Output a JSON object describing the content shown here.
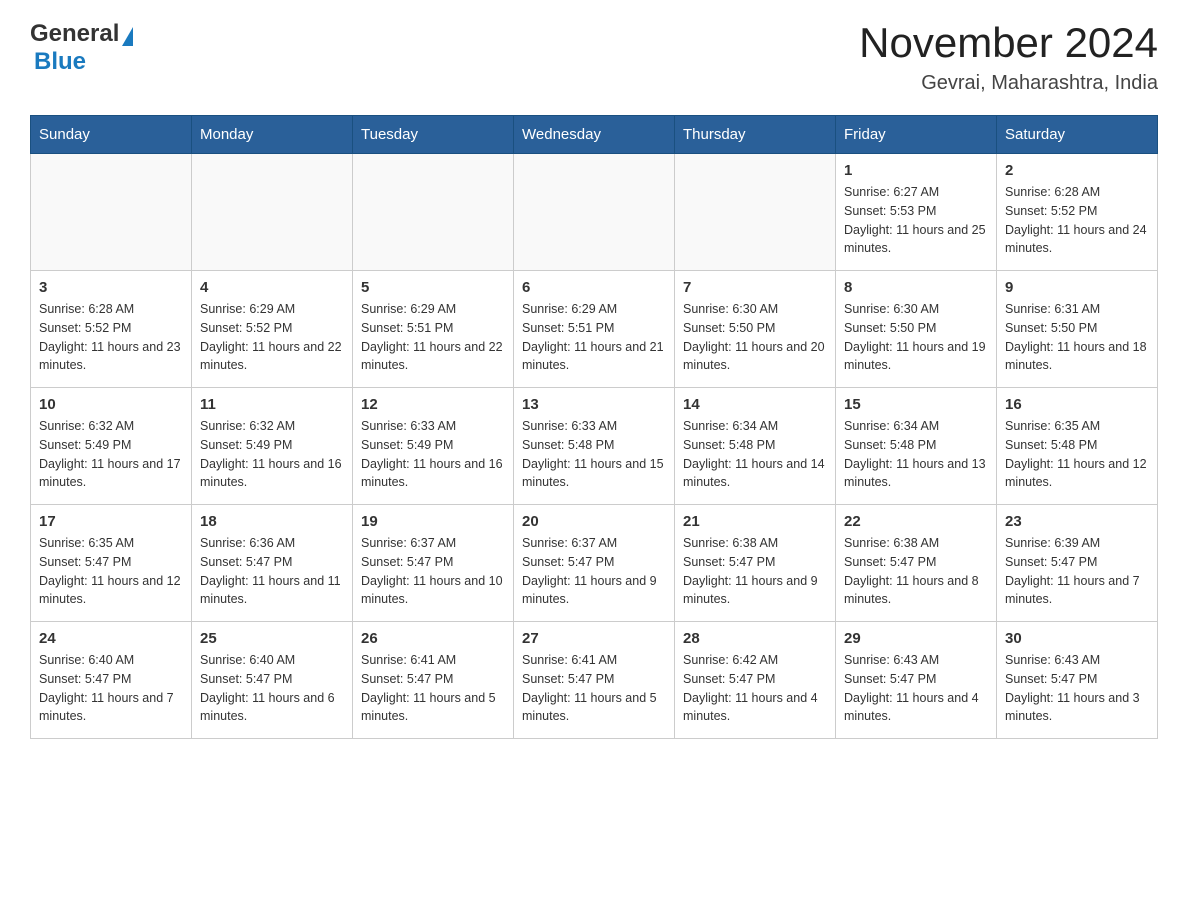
{
  "header": {
    "logo": {
      "general": "General",
      "blue": "Blue"
    },
    "title": "November 2024",
    "location": "Gevrai, Maharashtra, India"
  },
  "calendar": {
    "days_of_week": [
      "Sunday",
      "Monday",
      "Tuesday",
      "Wednesday",
      "Thursday",
      "Friday",
      "Saturday"
    ],
    "weeks": [
      [
        {
          "day": "",
          "info": ""
        },
        {
          "day": "",
          "info": ""
        },
        {
          "day": "",
          "info": ""
        },
        {
          "day": "",
          "info": ""
        },
        {
          "day": "",
          "info": ""
        },
        {
          "day": "1",
          "info": "Sunrise: 6:27 AM\nSunset: 5:53 PM\nDaylight: 11 hours and 25 minutes."
        },
        {
          "day": "2",
          "info": "Sunrise: 6:28 AM\nSunset: 5:52 PM\nDaylight: 11 hours and 24 minutes."
        }
      ],
      [
        {
          "day": "3",
          "info": "Sunrise: 6:28 AM\nSunset: 5:52 PM\nDaylight: 11 hours and 23 minutes."
        },
        {
          "day": "4",
          "info": "Sunrise: 6:29 AM\nSunset: 5:52 PM\nDaylight: 11 hours and 22 minutes."
        },
        {
          "day": "5",
          "info": "Sunrise: 6:29 AM\nSunset: 5:51 PM\nDaylight: 11 hours and 22 minutes."
        },
        {
          "day": "6",
          "info": "Sunrise: 6:29 AM\nSunset: 5:51 PM\nDaylight: 11 hours and 21 minutes."
        },
        {
          "day": "7",
          "info": "Sunrise: 6:30 AM\nSunset: 5:50 PM\nDaylight: 11 hours and 20 minutes."
        },
        {
          "day": "8",
          "info": "Sunrise: 6:30 AM\nSunset: 5:50 PM\nDaylight: 11 hours and 19 minutes."
        },
        {
          "day": "9",
          "info": "Sunrise: 6:31 AM\nSunset: 5:50 PM\nDaylight: 11 hours and 18 minutes."
        }
      ],
      [
        {
          "day": "10",
          "info": "Sunrise: 6:32 AM\nSunset: 5:49 PM\nDaylight: 11 hours and 17 minutes."
        },
        {
          "day": "11",
          "info": "Sunrise: 6:32 AM\nSunset: 5:49 PM\nDaylight: 11 hours and 16 minutes."
        },
        {
          "day": "12",
          "info": "Sunrise: 6:33 AM\nSunset: 5:49 PM\nDaylight: 11 hours and 16 minutes."
        },
        {
          "day": "13",
          "info": "Sunrise: 6:33 AM\nSunset: 5:48 PM\nDaylight: 11 hours and 15 minutes."
        },
        {
          "day": "14",
          "info": "Sunrise: 6:34 AM\nSunset: 5:48 PM\nDaylight: 11 hours and 14 minutes."
        },
        {
          "day": "15",
          "info": "Sunrise: 6:34 AM\nSunset: 5:48 PM\nDaylight: 11 hours and 13 minutes."
        },
        {
          "day": "16",
          "info": "Sunrise: 6:35 AM\nSunset: 5:48 PM\nDaylight: 11 hours and 12 minutes."
        }
      ],
      [
        {
          "day": "17",
          "info": "Sunrise: 6:35 AM\nSunset: 5:47 PM\nDaylight: 11 hours and 12 minutes."
        },
        {
          "day": "18",
          "info": "Sunrise: 6:36 AM\nSunset: 5:47 PM\nDaylight: 11 hours and 11 minutes."
        },
        {
          "day": "19",
          "info": "Sunrise: 6:37 AM\nSunset: 5:47 PM\nDaylight: 11 hours and 10 minutes."
        },
        {
          "day": "20",
          "info": "Sunrise: 6:37 AM\nSunset: 5:47 PM\nDaylight: 11 hours and 9 minutes."
        },
        {
          "day": "21",
          "info": "Sunrise: 6:38 AM\nSunset: 5:47 PM\nDaylight: 11 hours and 9 minutes."
        },
        {
          "day": "22",
          "info": "Sunrise: 6:38 AM\nSunset: 5:47 PM\nDaylight: 11 hours and 8 minutes."
        },
        {
          "day": "23",
          "info": "Sunrise: 6:39 AM\nSunset: 5:47 PM\nDaylight: 11 hours and 7 minutes."
        }
      ],
      [
        {
          "day": "24",
          "info": "Sunrise: 6:40 AM\nSunset: 5:47 PM\nDaylight: 11 hours and 7 minutes."
        },
        {
          "day": "25",
          "info": "Sunrise: 6:40 AM\nSunset: 5:47 PM\nDaylight: 11 hours and 6 minutes."
        },
        {
          "day": "26",
          "info": "Sunrise: 6:41 AM\nSunset: 5:47 PM\nDaylight: 11 hours and 5 minutes."
        },
        {
          "day": "27",
          "info": "Sunrise: 6:41 AM\nSunset: 5:47 PM\nDaylight: 11 hours and 5 minutes."
        },
        {
          "day": "28",
          "info": "Sunrise: 6:42 AM\nSunset: 5:47 PM\nDaylight: 11 hours and 4 minutes."
        },
        {
          "day": "29",
          "info": "Sunrise: 6:43 AM\nSunset: 5:47 PM\nDaylight: 11 hours and 4 minutes."
        },
        {
          "day": "30",
          "info": "Sunrise: 6:43 AM\nSunset: 5:47 PM\nDaylight: 11 hours and 3 minutes."
        }
      ]
    ]
  }
}
